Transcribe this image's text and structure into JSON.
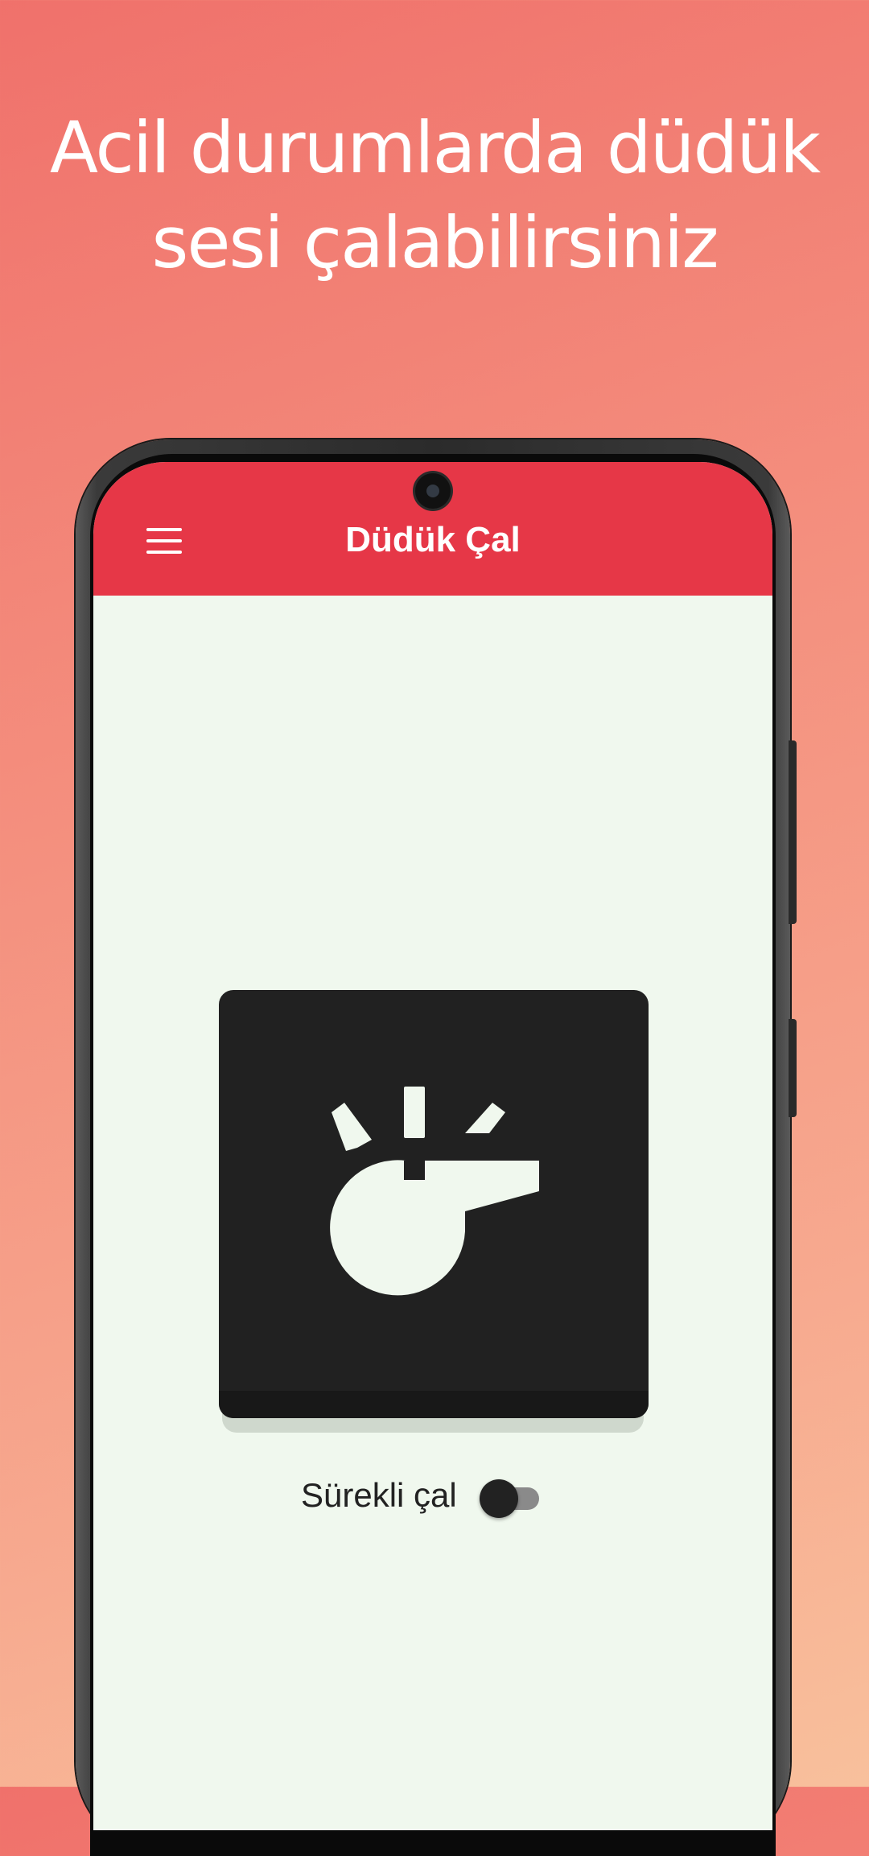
{
  "headline": {
    "line1": "Acil durumlarda düdük",
    "line2": "sesi çalabilirsiniz"
  },
  "appbar": {
    "title": "Düdük Çal",
    "menu_icon": "hamburger-menu-icon",
    "color": "#e63747"
  },
  "main": {
    "whistle_button_icon": "whistle-icon",
    "toggle_label": "Sürekli çal",
    "toggle_on": false
  },
  "colors": {
    "background_start": "#f0716b",
    "background_end": "#f8c09c",
    "screen_background": "#f0f8ee",
    "button_dark": "#212121"
  }
}
